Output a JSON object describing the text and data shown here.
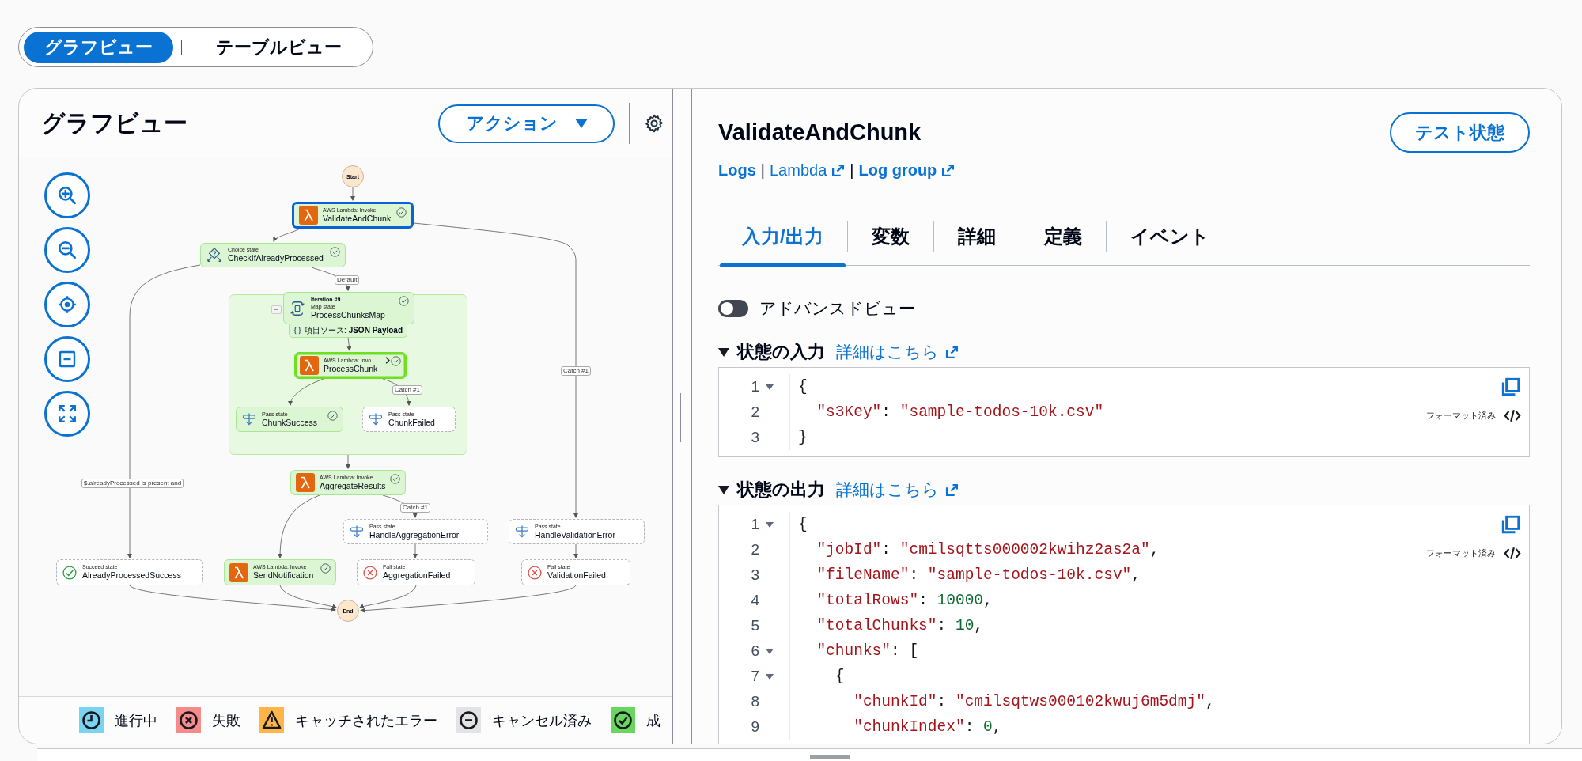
{
  "view_switch": [
    {
      "label": "グラフビュー",
      "selected": true
    },
    {
      "label": "テーブルビュー",
      "selected": false
    }
  ],
  "graph_panel": {
    "title": "グラフビュー",
    "action_button": "アクション",
    "nodes": [
      {
        "kind": "terminal",
        "name": "Start"
      },
      {
        "kind": "lambda",
        "type_label": "AWS Lambda: Invoke",
        "name": "ValidateAndChunk",
        "executed": true,
        "selected": true,
        "focused": false,
        "expandable": false
      },
      {
        "kind": "choice",
        "type_label": "Choice state",
        "name": "CheckIfAlreadyProcessed",
        "executed": true,
        "selected": false,
        "focused": false,
        "expandable": false
      },
      {
        "kind": "map",
        "iteration": "Iteration #9",
        "type_label": "Map state",
        "name": "ProcessChunksMap",
        "item_source": "項目ソース: **JSON Payload**",
        "executed": true,
        "selected": false,
        "focused": false,
        "expandable": false
      },
      {
        "kind": "lambda",
        "type_label": "AWS Lambda: Invo",
        "name": "ProcessChunk",
        "executed": true,
        "selected": false,
        "focused": true,
        "expandable": true
      },
      {
        "kind": "pass",
        "type_label": "Pass state",
        "name": "ChunkSuccess",
        "executed": true,
        "selected": false,
        "focused": false,
        "expandable": false
      },
      {
        "kind": "pass",
        "type_label": "Pass state",
        "name": "ChunkFailed",
        "executed": false,
        "selected": false,
        "focused": false,
        "expandable": false
      },
      {
        "kind": "lambda",
        "type_label": "AWS Lambda: Invoke",
        "name": "AggregateResults",
        "executed": true,
        "selected": false,
        "focused": false,
        "expandable": false
      },
      {
        "kind": "pass",
        "type_label": "Pass state",
        "name": "HandleAggregationError",
        "executed": false,
        "selected": false,
        "focused": false,
        "expandable": false
      },
      {
        "kind": "pass",
        "type_label": "Pass state",
        "name": "HandleValidationError",
        "executed": false,
        "selected": false,
        "focused": false,
        "expandable": false
      },
      {
        "kind": "succeed",
        "type_label": "Succeed state",
        "name": "AlreadyProcessedSuccess",
        "executed": false,
        "selected": false,
        "focused": false,
        "expandable": false
      },
      {
        "kind": "lambda",
        "type_label": "AWS Lambda: Invoke",
        "name": "SendNotification",
        "executed": true,
        "selected": false,
        "focused": false,
        "expandable": false
      },
      {
        "kind": "fail",
        "type_label": "Fail state",
        "name": "AggregationFailed",
        "executed": false,
        "selected": false,
        "focused": false,
        "expandable": false
      },
      {
        "kind": "fail",
        "type_label": "Fail state",
        "name": "ValidationFailed",
        "executed": false,
        "selected": false,
        "focused": false,
        "expandable": false
      },
      {
        "kind": "terminal",
        "name": "End"
      }
    ],
    "edge_labels": [
      "Default",
      "Catch #1",
      "Catch #1",
      "$.alreadyProcessed is present and",
      "Catch #1"
    ],
    "legend": [
      {
        "kind": "in_progress",
        "label": "進行中"
      },
      {
        "kind": "failed",
        "label": "失敗"
      },
      {
        "kind": "caught",
        "label": "キャッチされたエラー"
      },
      {
        "kind": "cancelled",
        "label": "キャンセル済み"
      },
      {
        "kind": "succeeded",
        "label": "成"
      }
    ]
  },
  "detail_panel": {
    "title": "ValidateAndChunk",
    "test_button": "テスト状態",
    "links": [
      {
        "kind": "link",
        "label": "Logs",
        "bold": true,
        "external": false
      },
      {
        "kind": "separator",
        "label": "|"
      },
      {
        "kind": "link",
        "label": "Lambda",
        "bold": false,
        "external": true
      },
      {
        "kind": "separator",
        "label": "|"
      },
      {
        "kind": "link",
        "label": "Log group",
        "bold": true,
        "external": true
      }
    ],
    "tabs": [
      {
        "label": "入力/出力",
        "selected": true
      },
      {
        "label": "変数",
        "selected": false
      },
      {
        "label": "詳細",
        "selected": false
      },
      {
        "label": "定義",
        "selected": false
      },
      {
        "label": "イベント",
        "selected": false
      }
    ],
    "advanced_view": {
      "label": "アドバンスドビュー",
      "on": false
    },
    "sections": [
      {
        "title": "状態の入力",
        "expanded": true,
        "link": "詳細はこちら",
        "format_label": "フォーマット済み",
        "lines": [
          {
            "number": "1",
            "foldable": true,
            "tokens": [
              {
                "t": "{",
                "kind": "punctuation"
              }
            ]
          },
          {
            "number": "2",
            "foldable": false,
            "tokens": [
              {
                "t": "  \"s3Key\"",
                "kind": "key"
              },
              {
                "t": ": ",
                "kind": "punctuation"
              },
              {
                "t": "\"sample-todos-10k.csv\"",
                "kind": "string"
              }
            ]
          },
          {
            "number": "3",
            "foldable": false,
            "tokens": [
              {
                "t": "}",
                "kind": "punctuation"
              }
            ]
          }
        ]
      },
      {
        "title": "状態の出力",
        "expanded": true,
        "link": "詳細はこちら",
        "format_label": "フォーマット済み",
        "lines": [
          {
            "number": "1",
            "foldable": true,
            "tokens": [
              {
                "t": "{",
                "kind": "punctuation"
              }
            ]
          },
          {
            "number": "2",
            "foldable": false,
            "tokens": [
              {
                "t": "  \"jobId\"",
                "kind": "key"
              },
              {
                "t": ": ",
                "kind": "punctuation"
              },
              {
                "t": "\"cmilsqtts000002kwihz2as2a\"",
                "kind": "string"
              },
              {
                "t": ",",
                "kind": "punctuation"
              }
            ]
          },
          {
            "number": "3",
            "foldable": false,
            "tokens": [
              {
                "t": "  \"fileName\"",
                "kind": "key"
              },
              {
                "t": ": ",
                "kind": "punctuation"
              },
              {
                "t": "\"sample-todos-10k.csv\"",
                "kind": "string"
              },
              {
                "t": ",",
                "kind": "punctuation"
              }
            ]
          },
          {
            "number": "4",
            "foldable": false,
            "tokens": [
              {
                "t": "  \"totalRows\"",
                "kind": "key"
              },
              {
                "t": ": ",
                "kind": "punctuation"
              },
              {
                "t": "10000",
                "kind": "number"
              },
              {
                "t": ",",
                "kind": "punctuation"
              }
            ]
          },
          {
            "number": "5",
            "foldable": false,
            "tokens": [
              {
                "t": "  \"totalChunks\"",
                "kind": "key"
              },
              {
                "t": ": ",
                "kind": "punctuation"
              },
              {
                "t": "10",
                "kind": "number"
              },
              {
                "t": ",",
                "kind": "punctuation"
              }
            ]
          },
          {
            "number": "6",
            "foldable": true,
            "tokens": [
              {
                "t": "  \"chunks\"",
                "kind": "key"
              },
              {
                "t": ": [",
                "kind": "punctuation"
              }
            ]
          },
          {
            "number": "7",
            "foldable": true,
            "tokens": [
              {
                "t": "    {",
                "kind": "punctuation"
              }
            ]
          },
          {
            "number": "8",
            "foldable": false,
            "tokens": [
              {
                "t": "      \"chunkId\"",
                "kind": "key"
              },
              {
                "t": ": ",
                "kind": "punctuation"
              },
              {
                "t": "\"cmilsqtws000102kwuj6m5dmj\"",
                "kind": "string"
              },
              {
                "t": ",",
                "kind": "punctuation"
              }
            ]
          },
          {
            "number": "9",
            "foldable": false,
            "tokens": [
              {
                "t": "      \"chunkIndex\"",
                "kind": "key"
              },
              {
                "t": ": ",
                "kind": "punctuation"
              },
              {
                "t": "0",
                "kind": "number"
              },
              {
                "t": ",",
                "kind": "punctuation"
              }
            ]
          }
        ]
      }
    ]
  }
}
